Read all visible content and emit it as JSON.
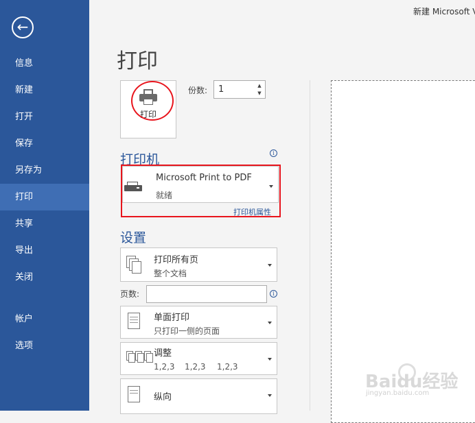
{
  "window": {
    "title": "新建 Microsoft V"
  },
  "sidebar": {
    "back_icon": "back-arrow-icon",
    "items": [
      {
        "label": "信息"
      },
      {
        "label": "新建"
      },
      {
        "label": "打开"
      },
      {
        "label": "保存"
      },
      {
        "label": "另存为"
      },
      {
        "label": "打印"
      },
      {
        "label": "共享"
      },
      {
        "label": "导出"
      },
      {
        "label": "关闭"
      },
      {
        "label": "帐户"
      },
      {
        "label": "选项"
      }
    ],
    "active": "打印",
    "bg_color": "#2b579a",
    "active_color": "#3f6eb4"
  },
  "main": {
    "title": "打印",
    "print_button": {
      "label": "打印",
      "icon": "printer-icon"
    },
    "copies": {
      "label": "份数:",
      "value": "1"
    },
    "printer": {
      "heading": "打印机",
      "name": "Microsoft Print to PDF",
      "status": "就绪",
      "properties_link": "打印机属性"
    },
    "settings": {
      "heading": "设置",
      "range": {
        "main": "打印所有页",
        "sub": "整个文档"
      },
      "pages_label": "页数:",
      "pages_value": "",
      "sides": {
        "main": "单面打印",
        "sub": "只打印一侧的页面"
      },
      "collate": {
        "main": "调整",
        "sub": [
          "1,2,3",
          "1,2,3",
          "1,2,3"
        ]
      },
      "orientation": {
        "main": "纵向"
      }
    }
  },
  "watermark": {
    "brand": "Baidu经验",
    "url": "jingyan.baidu.com"
  },
  "annotation_color": "#e8141c"
}
